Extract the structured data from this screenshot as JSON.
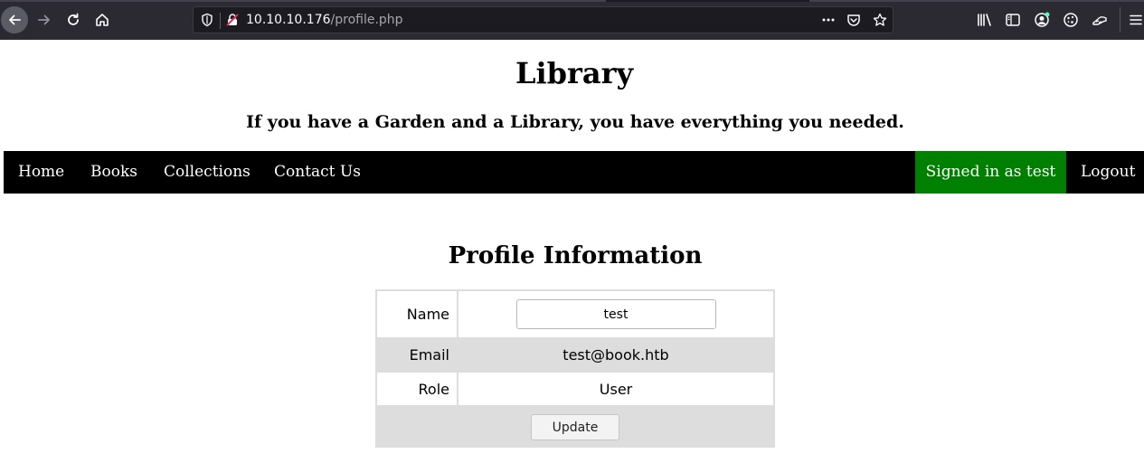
{
  "browser": {
    "url_host": "10.10.10.176",
    "url_path": "/profile.php",
    "icons": [
      "back-arrow-icon",
      "forward-arrow-icon",
      "reload-icon",
      "home-icon",
      "shield-icon",
      "insecure-lock-icon",
      "more-dots-icon",
      "pocket-icon",
      "bookmark-star-icon",
      "library-icon",
      "sidebar-icon",
      "account-icon",
      "cookie-icon",
      "extension-icon",
      "menu-icon"
    ]
  },
  "site": {
    "title": "Library",
    "tagline": "If you have a Garden and a Library, you have everything you needed."
  },
  "nav": {
    "items": [
      "Home",
      "Books",
      "Collections",
      "Contact Us"
    ],
    "signed_in": "Signed in as test",
    "logout": "Logout",
    "signed_in_color": "#008000"
  },
  "profile": {
    "heading": "Profile Information",
    "name_label": "Name",
    "name_value": "test",
    "email_label": "Email",
    "email_value": "test@book.htb",
    "role_label": "Role",
    "role_value": "User",
    "update_label": "Update"
  }
}
